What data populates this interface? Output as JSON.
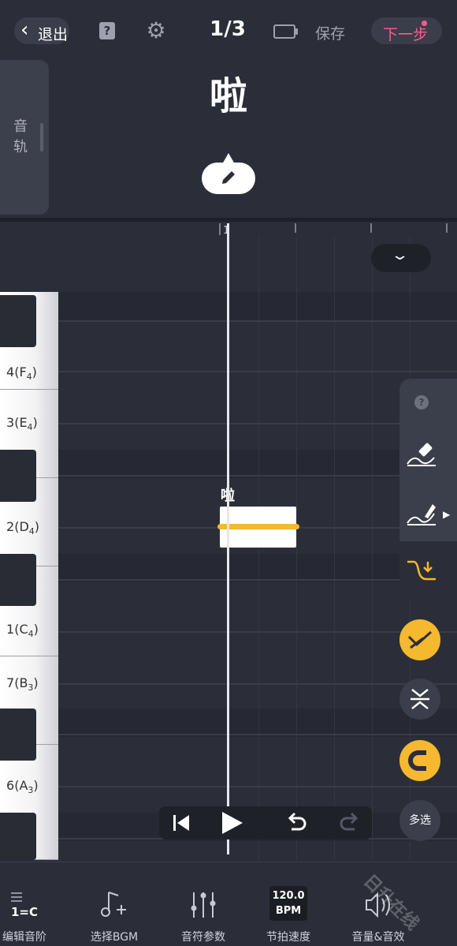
{
  "topbar": {
    "exit_label": "退出",
    "page_counter": "1/3",
    "save_label": "保存",
    "next_label": "下一步"
  },
  "lyric": {
    "track_tab_label": "音轨",
    "current_char": "啦"
  },
  "ruler": {
    "measure_number": "1"
  },
  "piano_keys": [
    {
      "label": "4",
      "note": "F",
      "octave": "4"
    },
    {
      "label": "3",
      "note": "E",
      "octave": "4"
    },
    {
      "label": "2",
      "note": "D",
      "octave": "4"
    },
    {
      "label": "1",
      "note": "C",
      "octave": "4"
    },
    {
      "label": "7",
      "note": "B",
      "octave": "3"
    },
    {
      "label": "6",
      "note": "A",
      "octave": "3"
    }
  ],
  "note": {
    "lyric": "啦"
  },
  "tools": {
    "multi_select_label": "多选"
  },
  "bottom_bar": {
    "items": [
      {
        "label": "编辑音阶",
        "icon": "1=C"
      },
      {
        "label": "选择BGM"
      },
      {
        "label": "音符参数"
      },
      {
        "label": "节拍速度",
        "bpm_value": "120.0",
        "bpm_unit": "BPM"
      },
      {
        "label": "音量&音效"
      }
    ]
  },
  "watermark": "日升在线",
  "colors": {
    "background": "#2b2e39",
    "accent_yellow": "#f5b82e",
    "accent_pink": "#ff5c8a"
  }
}
